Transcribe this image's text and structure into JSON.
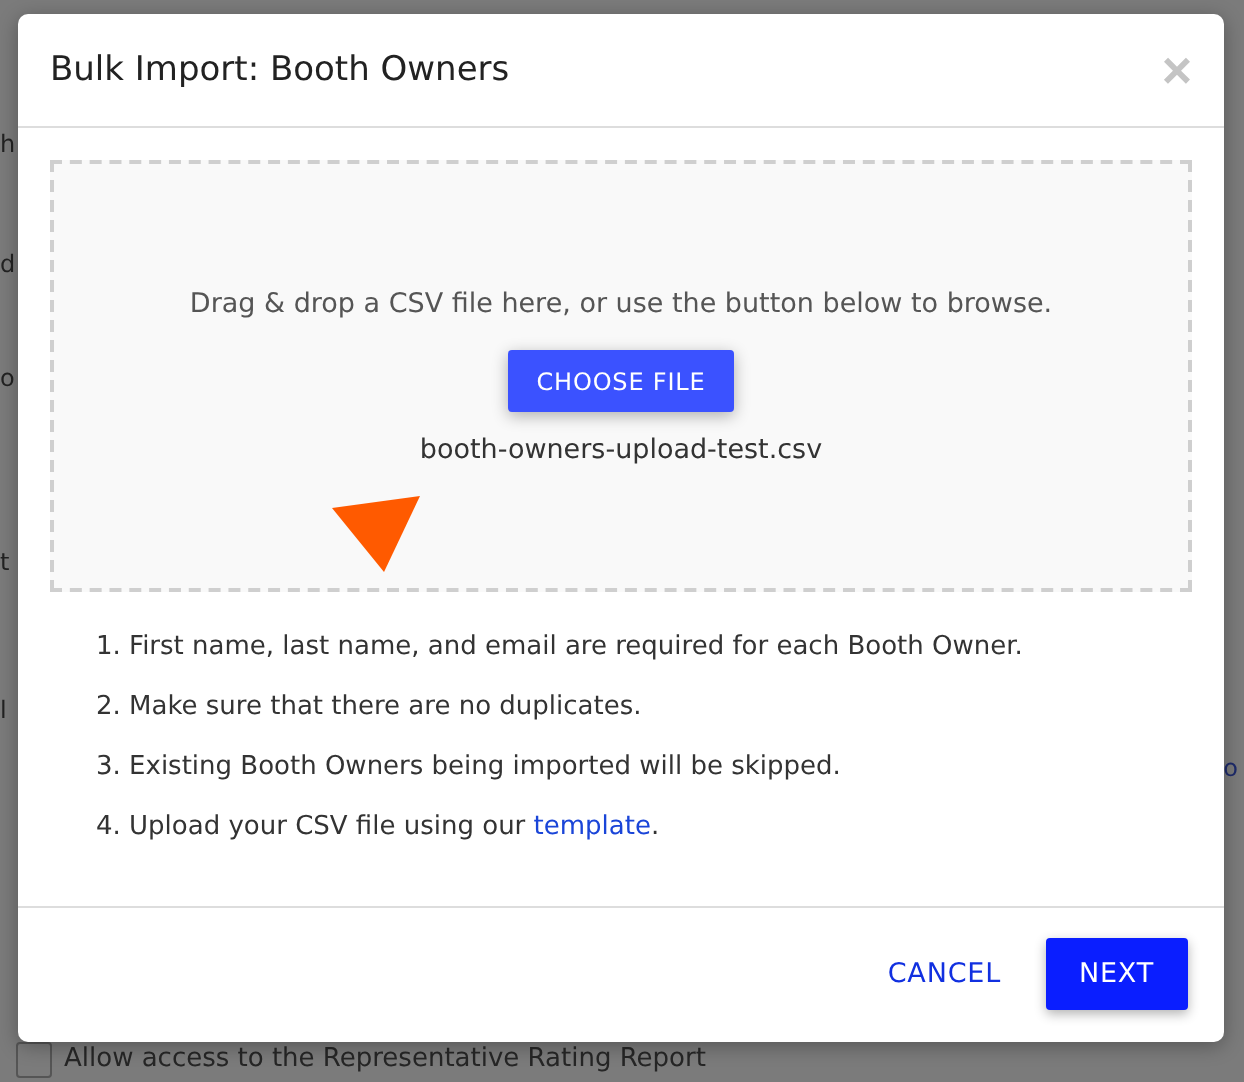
{
  "background_page": {
    "fragments": [
      {
        "text": "h"
      },
      {
        "text": "d"
      },
      {
        "text": "o"
      },
      {
        "text": "t"
      },
      {
        "text": "l"
      }
    ],
    "right_fragment": "o",
    "checkbox": {
      "label": "Allow access to the Representative Rating Report",
      "checked": false
    }
  },
  "dialog": {
    "title": "Bulk Import: Booth Owners",
    "close": "×",
    "dropzone": {
      "prompt": "Drag & drop a CSV file here, or use the button below to browse.",
      "button": "CHOOSE FILE",
      "file_name": "booth-owners-upload-test.csv"
    },
    "instructions": [
      {
        "number": "1.",
        "text": "First name, last name, and email are required for each Booth Owner."
      },
      {
        "number": "2.",
        "text": "Make sure that there are no duplicates."
      },
      {
        "number": "3.",
        "text": "Existing Booth Owners being imported will be skipped."
      },
      {
        "number": "4.",
        "text": "Upload your CSV file using our ",
        "link": "template",
        "after": "."
      }
    ],
    "buttons": [
      {
        "label": "CANCEL",
        "kind": "text"
      },
      {
        "label": "NEXT",
        "kind": "primary"
      }
    ]
  }
}
